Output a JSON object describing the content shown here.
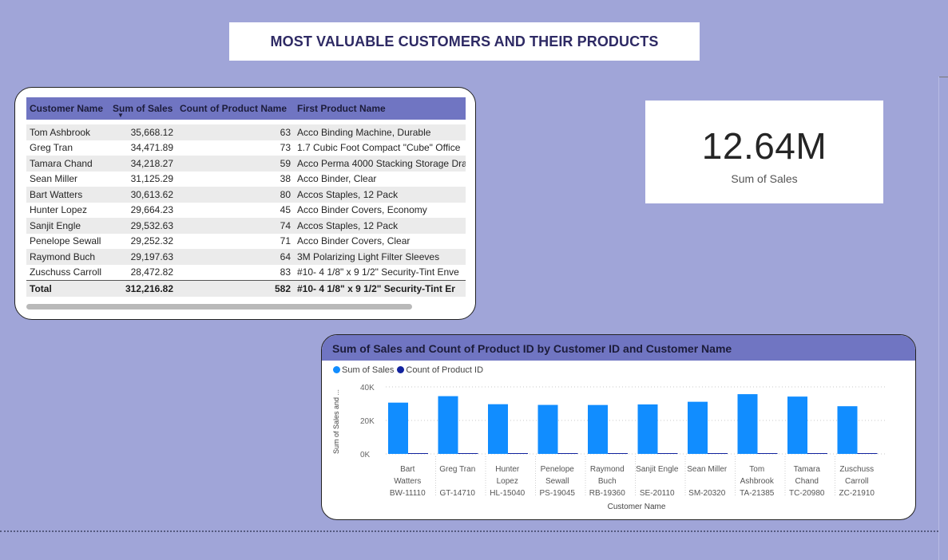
{
  "report": {
    "title": "MOST VALUABLE CUSTOMERS AND THEIR PRODUCTS"
  },
  "table": {
    "headers": [
      "Customer Name",
      "Sum of Sales",
      "Count of Product Name",
      "First Product Name"
    ],
    "rows": [
      [
        "Tom Ashbrook",
        "35,668.12",
        "63",
        "Acco Binding Machine, Durable"
      ],
      [
        "Greg Tran",
        "34,471.89",
        "73",
        "1.7 Cubic Foot Compact \"Cube\" Office"
      ],
      [
        "Tamara Chand",
        "34,218.27",
        "59",
        "Acco Perma 4000 Stacking Storage Dra"
      ],
      [
        "Sean Miller",
        "31,125.29",
        "38",
        "Acco Binder, Clear"
      ],
      [
        "Bart Watters",
        "30,613.62",
        "80",
        "Accos Staples, 12 Pack"
      ],
      [
        "Hunter Lopez",
        "29,664.23",
        "45",
        "Acco Binder Covers, Economy"
      ],
      [
        "Sanjit Engle",
        "29,532.63",
        "74",
        "Accos Staples, 12 Pack"
      ],
      [
        "Penelope Sewall",
        "29,252.32",
        "71",
        "Acco Binder Covers, Clear"
      ],
      [
        "Raymond Buch",
        "29,197.63",
        "64",
        "3M Polarizing Light Filter Sleeves"
      ],
      [
        "Zuschuss Carroll",
        "28,472.82",
        "83",
        "#10- 4 1/8\" x 9 1/2\" Security-Tint Enve"
      ]
    ],
    "total": [
      "Total",
      "312,216.82",
      "582",
      "#10- 4 1/8\" x 9 1/2\" Security-Tint Er"
    ]
  },
  "kpi": {
    "value": "12.64M",
    "label": "Sum of Sales"
  },
  "chart_data": {
    "type": "bar",
    "title": "Sum of Sales and Count of Product ID by Customer ID and Customer Name",
    "xlabel": "Customer Name",
    "ylabel": "Sum of Sales and ...",
    "ylim": [
      0,
      40000
    ],
    "yticks": [
      "0K",
      "20K",
      "40K"
    ],
    "categories": [
      [
        "Bart",
        "Watters",
        "BW-11110"
      ],
      [
        "Greg Tran",
        "",
        "GT-14710"
      ],
      [
        "Hunter",
        "Lopez",
        "HL-15040"
      ],
      [
        "Penelope",
        "Sewall",
        "PS-19045"
      ],
      [
        "Raymond",
        "Buch",
        "RB-19360"
      ],
      [
        "Sanjit Engle",
        "",
        "SE-20110"
      ],
      [
        "Sean Miller",
        "",
        "SM-20320"
      ],
      [
        "Tom",
        "Ashbrook",
        "TA-21385"
      ],
      [
        "Tamara",
        "Chand",
        "TC-20980"
      ],
      [
        "Zuschuss",
        "Carroll",
        "ZC-21910"
      ]
    ],
    "series": [
      {
        "name": "Sum of Sales",
        "color": "#118dff",
        "values": [
          30614,
          34472,
          29664,
          29252,
          29198,
          29533,
          31125,
          35668,
          34218,
          28473
        ]
      },
      {
        "name": "Count of Product ID",
        "color": "#12239e",
        "values": [
          80,
          73,
          45,
          71,
          64,
          74,
          38,
          63,
          59,
          83
        ]
      }
    ],
    "legend_position": "top-left",
    "grid": true
  }
}
